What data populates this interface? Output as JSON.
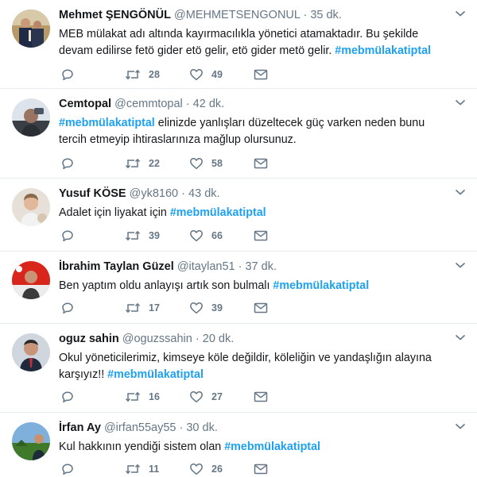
{
  "tweets": [
    {
      "name": "Mehmet ŞENGÖNÜL",
      "handle": "@MEHMETSENGONUL",
      "dot": "·",
      "time": "35 dk.",
      "text_parts": [
        "MEB mülakat adı altında kayırmacılıkla yönetici atamaktadır. Bu şekilde devam edilirse fetö gider etö gelir, etö gider metö gelir. ",
        "#mebmülakatiptal",
        ""
      ],
      "retweets": "28",
      "likes": "49"
    },
    {
      "name": "Cemtopal",
      "handle": "@cemmtopal",
      "dot": "·",
      "time": "42 dk.",
      "text_parts": [
        "",
        "#mebmülakatiptal",
        " elinizde yanlışları düzeltecek  güç varken neden bunu tercih etmeyip ihtiraslarınıza mağlup olursunuz."
      ],
      "retweets": "22",
      "likes": "58"
    },
    {
      "name": "Yusuf KÖSE",
      "handle": "@yk8160",
      "dot": "·",
      "time": "43 dk.",
      "text_parts": [
        "Adalet için liyakat için ",
        "#mebmülakatiptal",
        ""
      ],
      "retweets": "39",
      "likes": "66"
    },
    {
      "name": "İbrahim Taylan Güzel",
      "handle": "@itaylan51",
      "dot": "·",
      "time": "37 dk.",
      "text_parts": [
        "Ben yaptım oldu anlayışı artık son bulmalı ",
        "#mebmülakatiptal",
        ""
      ],
      "retweets": "17",
      "likes": "39"
    },
    {
      "name": "oguz sahin",
      "handle": "@oguzssahin",
      "dot": "·",
      "time": "20 dk.",
      "text_parts": [
        "Okul yöneticilerimiz, kimseye köle değildir, köleliğin ve yandaşlığın alayına karşıyız!! ",
        "#mebmülakatiptal",
        ""
      ],
      "retweets": "16",
      "likes": "27"
    },
    {
      "name": "İrfan Ay",
      "handle": "@irfan55ay55",
      "dot": "·",
      "time": "30 dk.",
      "text_parts": [
        "Kul hakkının yendiği sistem olan ",
        "#mebmülakatiptal",
        ""
      ],
      "retweets": "11",
      "likes": "26"
    }
  ],
  "icons": {
    "reply": "reply-icon",
    "retweet": "retweet-icon",
    "like": "heart-icon",
    "message": "envelope-icon",
    "menu": "chevron-down-icon"
  },
  "colors": {
    "hashtag": "#1da1f2",
    "muted": "#657786",
    "divider": "#e6ecf0"
  }
}
